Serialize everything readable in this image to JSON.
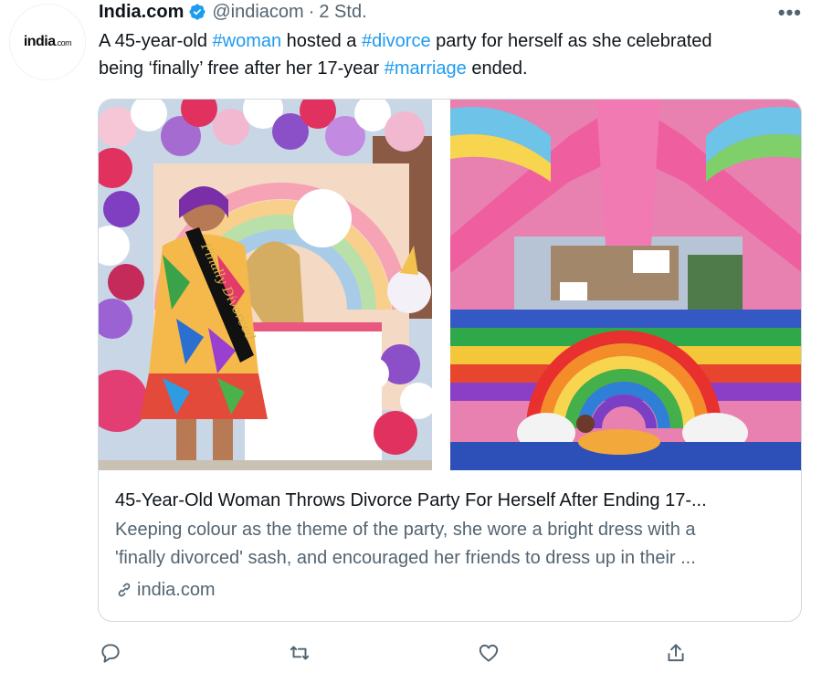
{
  "author": {
    "avatar_text": "india",
    "avatar_suffix": ".com",
    "name": "India.com",
    "handle": "@indiacom",
    "separator": "·",
    "time": "2 Std."
  },
  "tweet": {
    "text_parts": {
      "p1": "A 45-year-old ",
      "h1": "#woman",
      "p2": " hosted a ",
      "h2": "#divorce",
      "p3": " party for herself as she celebrated being ‘finally’ free after her 17-year ",
      "h3": "#marriage",
      "p4": " ended."
    }
  },
  "card": {
    "title": "45-Year-Old Woman Throws Divorce Party For Herself After Ending 17-...",
    "description_line1": "Keeping colour as the theme of the party, she wore a bright dress with a",
    "description_line2": "'finally divorced' sash, and encouraged her friends to dress up in their ...",
    "domain": "india.com",
    "sash_text": "Finally Divorced"
  },
  "icons": {
    "more": "more-icon",
    "verified": "verified-badge-icon",
    "link": "link-icon",
    "reply": "reply-icon",
    "retweet": "retweet-icon",
    "like": "like-icon",
    "share": "share-icon"
  },
  "colors": {
    "hashtag": "#1d9bf0",
    "secondary": "#536471",
    "verified": "#1d9bf0"
  }
}
